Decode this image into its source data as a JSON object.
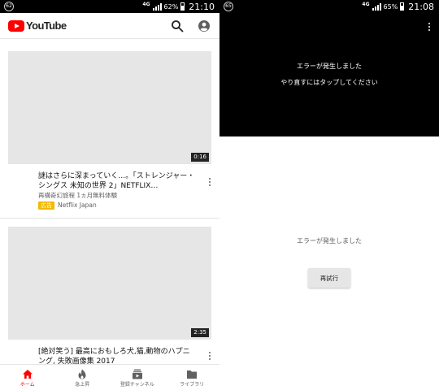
{
  "left": {
    "status": {
      "badge": "62",
      "network": "4G",
      "battery": "62%",
      "time": "21:10"
    },
    "header": {
      "wordmark": "YouTube"
    },
    "videos": [
      {
        "duration": "0:16",
        "title": "謎はさらに深まっていく…。「ストレンジャー・シングス 未知の世界 2」NETFLIX…",
        "subtitle": "再構奇幻旅程 1ヵ月無料体験",
        "ad_label": "広告",
        "channel": "Netflix Japan"
      },
      {
        "duration": "2:35",
        "title": "[絶対笑う] 最高におもしろ犬,猫,動物のハプニング, 失敗画像集 2017",
        "subtitle": "",
        "ad_label": "",
        "channel": ""
      }
    ],
    "nav": [
      {
        "label": "ホーム",
        "icon": "home-icon",
        "active": true
      },
      {
        "label": "急上昇",
        "icon": "flame-icon",
        "active": false
      },
      {
        "label": "登録チャンネル",
        "icon": "subscriptions-icon",
        "active": false
      },
      {
        "label": "ライブラリ",
        "icon": "folder-icon",
        "active": false
      }
    ]
  },
  "right": {
    "status": {
      "badge": "65",
      "network": "4G",
      "battery": "65%",
      "time": "21:08"
    },
    "player": {
      "error_title": "エラーが発生しました",
      "error_hint": "やり直すにはタップしてください"
    },
    "page": {
      "error_message": "エラーが発生しました",
      "retry_label": "再試行"
    }
  },
  "colors": {
    "brand_red": "#ff0000",
    "ad_yellow": "#f2b900",
    "placeholder": "#e6e6e6",
    "text_secondary": "#606060"
  }
}
